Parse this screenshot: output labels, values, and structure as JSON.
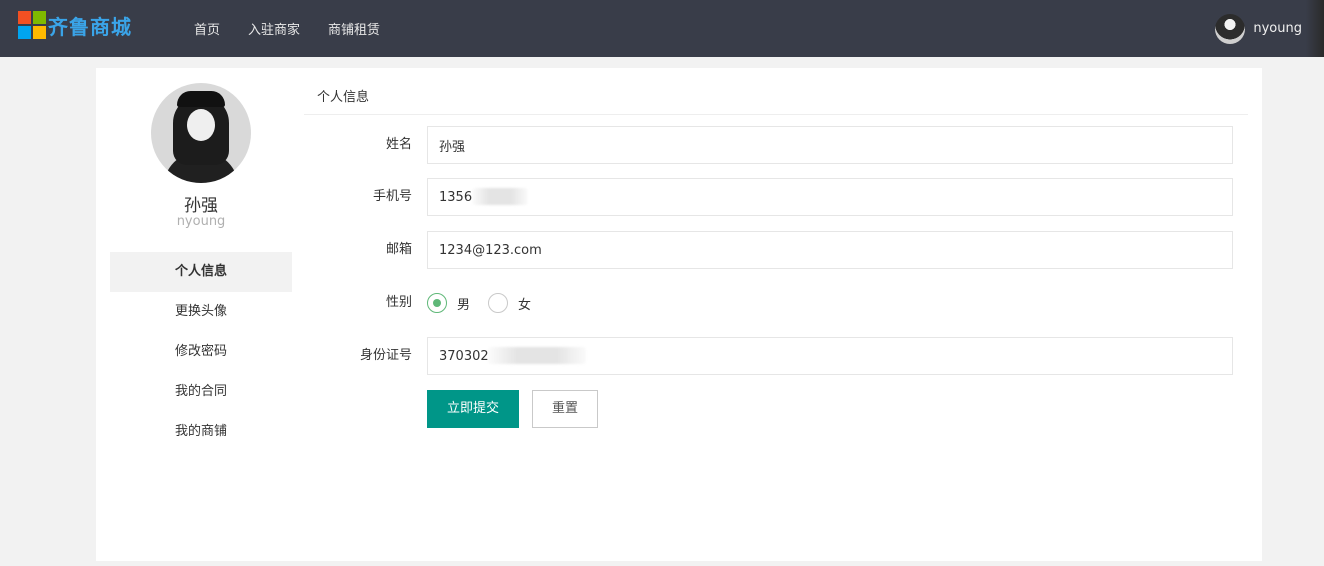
{
  "header": {
    "logo_text": "齐鲁商城",
    "nav": [
      "首页",
      "入驻商家",
      "商铺租赁"
    ],
    "username": "nyoung"
  },
  "profile": {
    "name": "孙强",
    "username": "nyoung"
  },
  "side_menu": {
    "items": [
      "个人信息",
      "更换头像",
      "修改密码",
      "我的合同",
      "我的商铺"
    ],
    "active_index": 0
  },
  "form": {
    "section_title": "个人信息",
    "name_label": "姓名",
    "name_value": "孙强",
    "phone_label": "手机号",
    "phone_value": "1356",
    "email_label": "邮箱",
    "email_value": "1234@123.com",
    "gender_label": "性别",
    "gender_options": [
      "男",
      "女"
    ],
    "gender_selected": "男",
    "id_label": "身份证号",
    "id_value": "370302",
    "submit_label": "立即提交",
    "reset_label": "重置"
  },
  "colors": {
    "header_bg": "#393d49",
    "primary": "#009688",
    "radio_checked": "#5fb878",
    "logo_text": "#3aa4e8"
  }
}
